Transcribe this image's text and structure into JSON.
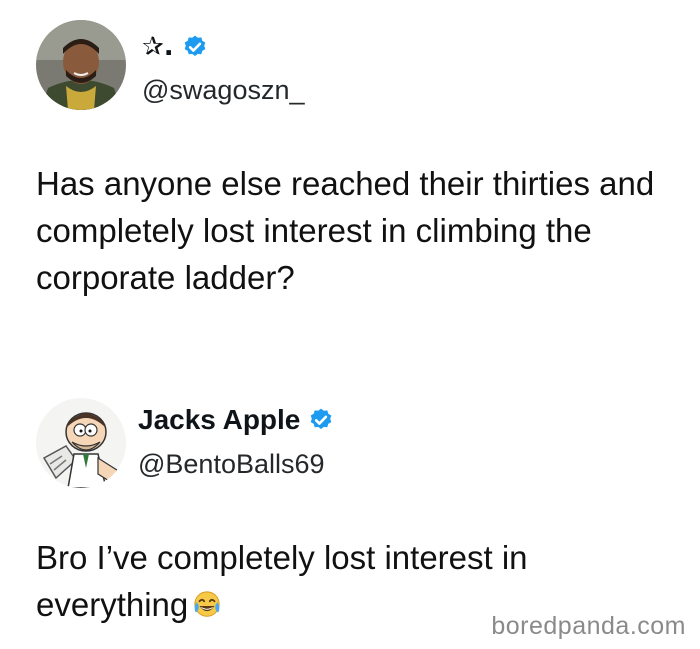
{
  "tweets": [
    {
      "display_name": "✰.",
      "handle": "@swagoszn_",
      "verified": true,
      "avatar_icon": "man-portrait-avatar-icon",
      "text": "Has anyone else reached their thirties and completely lost interest in climbing the corporate ladder?"
    },
    {
      "display_name": "Jacks Apple",
      "handle": "@BentoBalls69",
      "verified": true,
      "avatar_icon": "cartoon-character-avatar-icon",
      "text": "Bro I’ve completely lost interest in everything",
      "emoji_icon": "tears-of-joy-emoji-icon"
    }
  ],
  "watermark": "boredpanda.com",
  "colors": {
    "verified_blue": "#1d9bf0",
    "text": "#0f1419",
    "watermark": "#8a8a8a"
  }
}
